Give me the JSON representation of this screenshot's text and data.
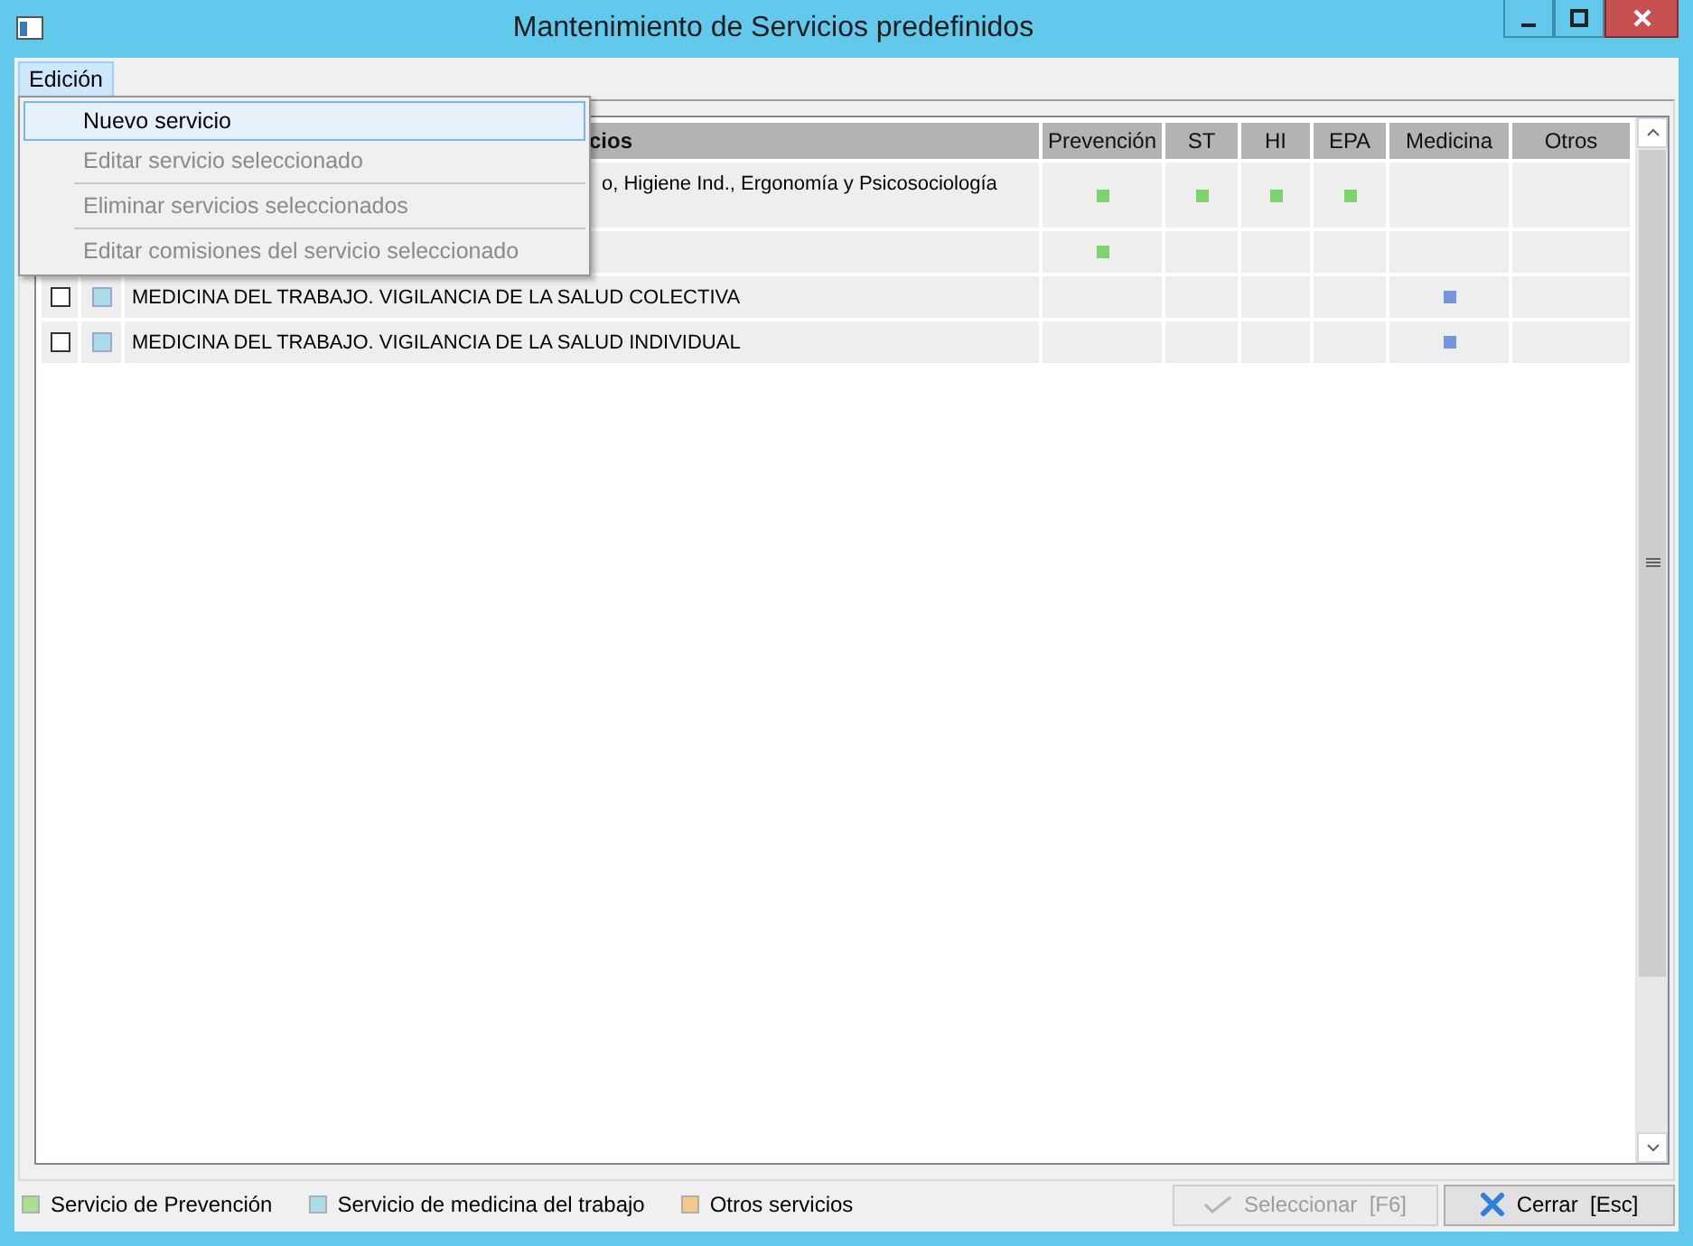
{
  "window": {
    "title": "Mantenimiento de Servicios predefinidos"
  },
  "menu_bar": [
    {
      "label": "Edición",
      "selected": true
    }
  ],
  "menu": [
    [
      {
        "label": "Nuevo servicio",
        "disabled": false,
        "selected": true
      },
      {
        "label": "Editar servicio seleccionado",
        "disabled": true,
        "selected": false
      }
    ],
    [
      {
        "label": "Eliminar servicios seleccionados",
        "disabled": true,
        "selected": false
      }
    ],
    [
      {
        "label": "Editar comisiones del servicio seleccionado",
        "disabled": true,
        "selected": false
      }
    ]
  ],
  "table": {
    "name_header": "cios",
    "columns": [
      {
        "label": "Prevención",
        "kind": "prevencion"
      },
      {
        "label": "ST",
        "kind": "prevencion"
      },
      {
        "label": "HI",
        "kind": "prevencion"
      },
      {
        "label": "EPA",
        "kind": "prevencion"
      },
      {
        "label": "Medicina",
        "kind": "medicina"
      },
      {
        "label": "Otros"
      }
    ],
    "rows": [
      {
        "name": "o, Higiene Ind., Ergonomía y Psicosociología",
        "marks": [
          true,
          true,
          true,
          true,
          false,
          false
        ]
      },
      {
        "marks": [
          true,
          false,
          false,
          false,
          false,
          false
        ]
      },
      {
        "name": "MEDICINA DEL TRABAJO. VIGILANCIA DE LA SALUD COLECTIVA",
        "checked": false,
        "kind": "medicina",
        "marks": [
          false,
          false,
          false,
          false,
          true,
          false
        ]
      },
      {
        "name": "MEDICINA DEL TRABAJO. VIGILANCIA DE LA SALUD INDIVIDUAL",
        "checked": false,
        "kind": "medicina",
        "marks": [
          false,
          false,
          false,
          false,
          true,
          false
        ]
      }
    ]
  },
  "legend": [
    {
      "label": "Servicio de Prevención",
      "color": "#a6e28f"
    },
    {
      "label": "Servicio de medicina del trabajo",
      "color": "#acdcea"
    },
    {
      "label": "Otros servicios",
      "color": "#f4c98a"
    }
  ],
  "buttons": [
    {
      "label": "Seleccionar  [F6]",
      "kind": "select",
      "disabled": true
    },
    {
      "label": "Cerrar  [Esc]",
      "kind": "close",
      "disabled": false
    }
  ]
}
